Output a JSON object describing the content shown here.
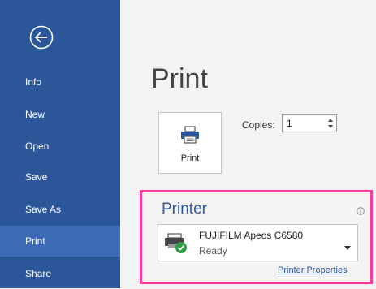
{
  "sidebar": {
    "items": [
      {
        "label": "Info"
      },
      {
        "label": "New"
      },
      {
        "label": "Open"
      },
      {
        "label": "Save"
      },
      {
        "label": "Save As"
      },
      {
        "label": "Print"
      },
      {
        "label": "Share"
      }
    ],
    "active": "Print"
  },
  "main": {
    "title": "Print",
    "print_button_label": "Print",
    "copies_label": "Copies:",
    "copies_value": "1"
  },
  "printer": {
    "heading": "Printer",
    "name": "FUJIFILM Apeos C6580",
    "status": "Ready",
    "properties_link": "Printer Properties"
  },
  "colors": {
    "sidebar_bg": "#2b579a",
    "sidebar_active_bg": "#3c6bb5",
    "highlight_border": "#ff3a9c",
    "accent": "#2b579a"
  }
}
